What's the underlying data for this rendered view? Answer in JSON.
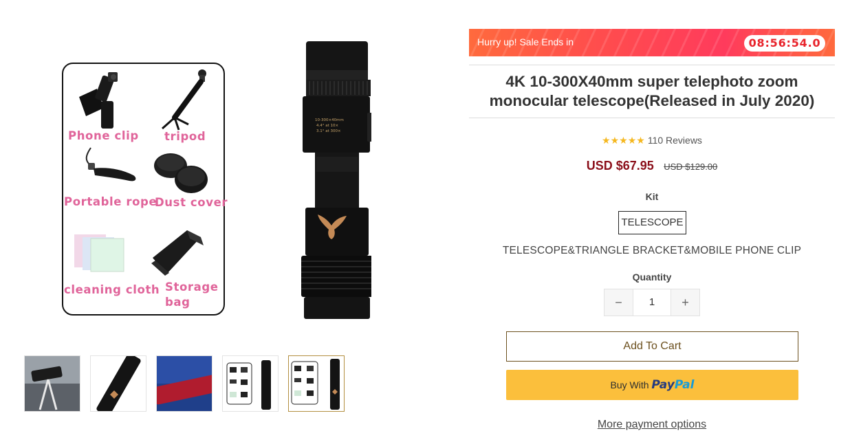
{
  "product_image": {
    "accessories": [
      {
        "name": "phone-clip",
        "label": "Phone clip"
      },
      {
        "name": "tripod",
        "label": "tripod"
      },
      {
        "name": "portable-rope",
        "label": "Portable rope"
      },
      {
        "name": "dust-cover",
        "label": "Dust cover"
      },
      {
        "name": "cleaning-cloth",
        "label": "cleaning cloth"
      },
      {
        "name": "storage-bag",
        "label": "Storage bag"
      }
    ],
    "scope_text": [
      "10-300×40mm",
      "4.4° at 10×",
      "3.1° at 300×"
    ]
  },
  "thumbnails": {
    "count": 5,
    "active_index": 4
  },
  "sale": {
    "text": "Hurry up! Sale Ends in",
    "countdown": "08:56:54.0"
  },
  "product": {
    "title": "4K 10-300X40mm super telephoto zoom monocular telescope(Released in July 2020)",
    "stars": "★★★★★",
    "reviews": "110 Reviews",
    "price": "USD $67.95",
    "compare_price": "USD $129.00"
  },
  "kit": {
    "label": "Kit",
    "selected": "TELESCOPE",
    "description": "TELESCOPE&TRIANGLE BRACKET&MOBILE PHONE CLIP"
  },
  "quantity": {
    "label": "Quantity",
    "value": "1",
    "minus": "−",
    "plus": "+"
  },
  "buttons": {
    "add_to_cart": "Add To Cart",
    "buy_with": "Buy With",
    "paypal_a": "Pay",
    "paypal_b": "Pal",
    "more_payment": "More payment options"
  },
  "colors": {
    "price": "#8b0f1a",
    "paypal_bg": "#fbbf3c",
    "accent": "#6b4f1d",
    "accessory_label": "#e0649a"
  }
}
